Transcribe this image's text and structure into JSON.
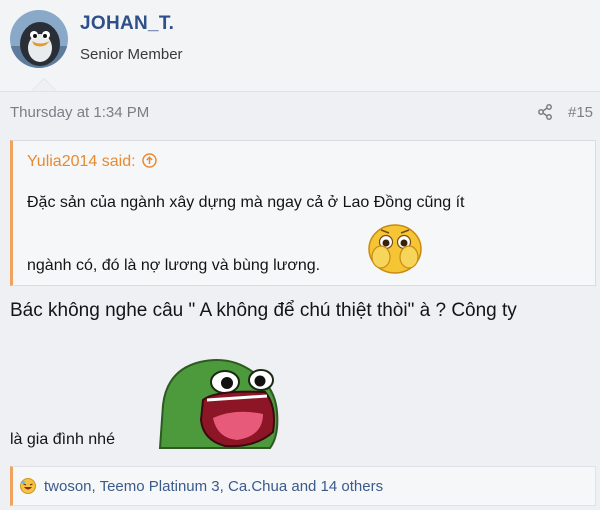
{
  "user": {
    "name": "JOHAN_T.",
    "title": "Senior Member"
  },
  "post": {
    "date": "Thursday at 1:34 PM",
    "number": "#15"
  },
  "quote": {
    "author_line": "Yulia2014 said:",
    "line1": "Đặc sản của ngành xây dựng mà ngay cả ở Lao Đồng cũng ít",
    "line2": "ngành có, đó là nợ lương và bùng lương."
  },
  "body": {
    "line1": "Bác không nghe câu \" A không để chú thiệt thòi\" à ? Công ty",
    "line2": "là gia đình nhé"
  },
  "reactions": {
    "text": "twoson, Teemo Platinum 3, Ca.Chua and 14 others"
  },
  "colors": {
    "username": "#2f4f8a",
    "quote_accent": "#f0a35e",
    "reaction_link": "#3b5a8c"
  },
  "icons": {
    "share": "share-icon",
    "quote_jump": "arrow-up-circle-icon",
    "reaction": "laugh-emoji-icon"
  }
}
